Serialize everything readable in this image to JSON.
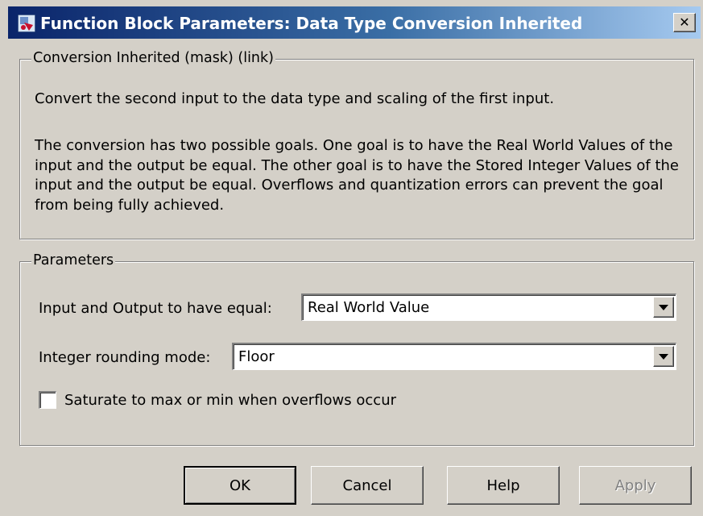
{
  "window": {
    "title": "Function Block Parameters: Data Type Conversion Inherited",
    "close_glyph": "✕"
  },
  "description": {
    "group_label": "Conversion Inherited (mask) (link)",
    "line1": "Convert the second input to the data type and scaling of the first input.",
    "paragraph": "The conversion has two possible goals.  One goal is to have the Real World Values of the input and the output be equal.  The other goal is to have the Stored Integer Values of the input and the output be equal.  Overflows and quantization errors can prevent the goal from being fully achieved."
  },
  "parameters": {
    "group_label": "Parameters",
    "equal_label": "Input and Output to have equal:",
    "equal_value": "Real World Value",
    "rounding_label": "Integer rounding mode:",
    "rounding_value": "Floor",
    "saturate_label": "Saturate to max or min when overflows occur",
    "saturate_checked": false
  },
  "buttons": {
    "ok": "OK",
    "cancel": "Cancel",
    "help": "Help",
    "apply": "Apply"
  },
  "colors": {
    "titlebar_start": "#0a246a",
    "titlebar_end": "#a6caf0",
    "face": "#d4d0c8",
    "disabled_text": "#808080"
  },
  "icons": {
    "app": "simulink-block-icon",
    "close": "close-icon",
    "dropdown": "chevron-down-icon"
  }
}
